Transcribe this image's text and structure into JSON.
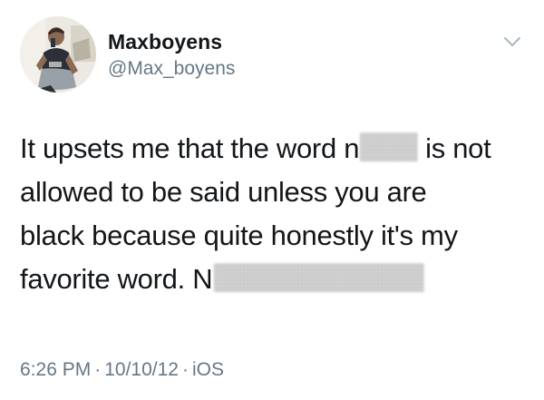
{
  "tweet": {
    "author": {
      "display_name": "Maxboyens",
      "handle": "@Max_boyens"
    },
    "body": {
      "line1_before": "It upsets me that the word n",
      "line1_after": "is not",
      "line2": "allowed to be said unless you are",
      "line3": "black because quite honestly it's my",
      "line4_before": "favorite word. N"
    },
    "meta": {
      "time": "6:26 PM",
      "separator": "·",
      "date": "10/10/12",
      "source": "iOS"
    },
    "icons": {
      "menu": "chevron-down-icon"
    },
    "colors": {
      "text": "#14171a",
      "secondary": "#657786",
      "background": "#ffffff"
    }
  }
}
